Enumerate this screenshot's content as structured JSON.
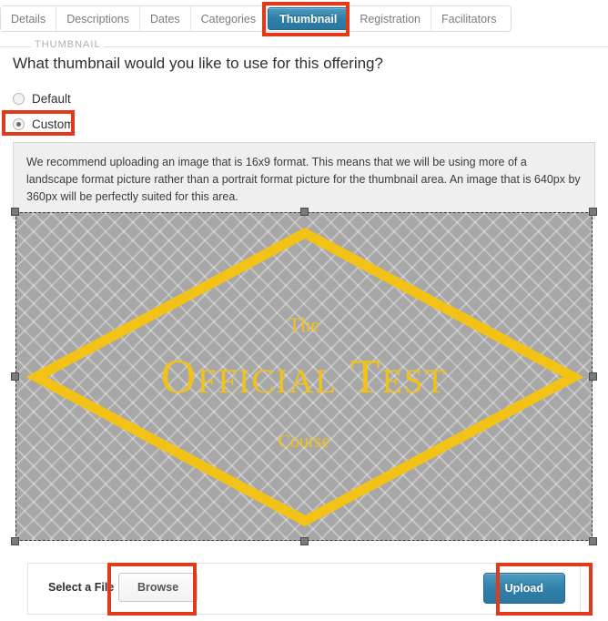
{
  "tabs": [
    {
      "label": "Details",
      "active": false
    },
    {
      "label": "Descriptions",
      "active": false
    },
    {
      "label": "Dates",
      "active": false
    },
    {
      "label": "Categories",
      "active": false
    },
    {
      "label": "Thumbnail",
      "active": true
    },
    {
      "label": "Registration",
      "active": false
    },
    {
      "label": "Facilitators",
      "active": false
    }
  ],
  "fieldset": {
    "legend": "THUMBNAIL",
    "question": "What thumbnail would you like to use for this offering?"
  },
  "radios": [
    {
      "label": "Default",
      "checked": false
    },
    {
      "label": "Custom",
      "checked": true
    }
  ],
  "info": {
    "text": "We recommend uploading an image that is 16x9 format. This means that we will be using more of a landscape format picture rather than a portrait format picture for the thumbnail area. An image that is 640px by 360px will be perfectly suited for this area."
  },
  "preview": {
    "line1": "The",
    "line2": "Official Test",
    "line3": "Course",
    "image_color": "#f3c216",
    "background_color": "#a7a7a7"
  },
  "form": {
    "select_file_label": "Select a File",
    "browse_label": "Browse",
    "upload_label": "Upload"
  },
  "highlights": {
    "color": "#e2391a",
    "targets": [
      "Thumbnail",
      "Custom",
      "Browse",
      "Upload"
    ]
  }
}
